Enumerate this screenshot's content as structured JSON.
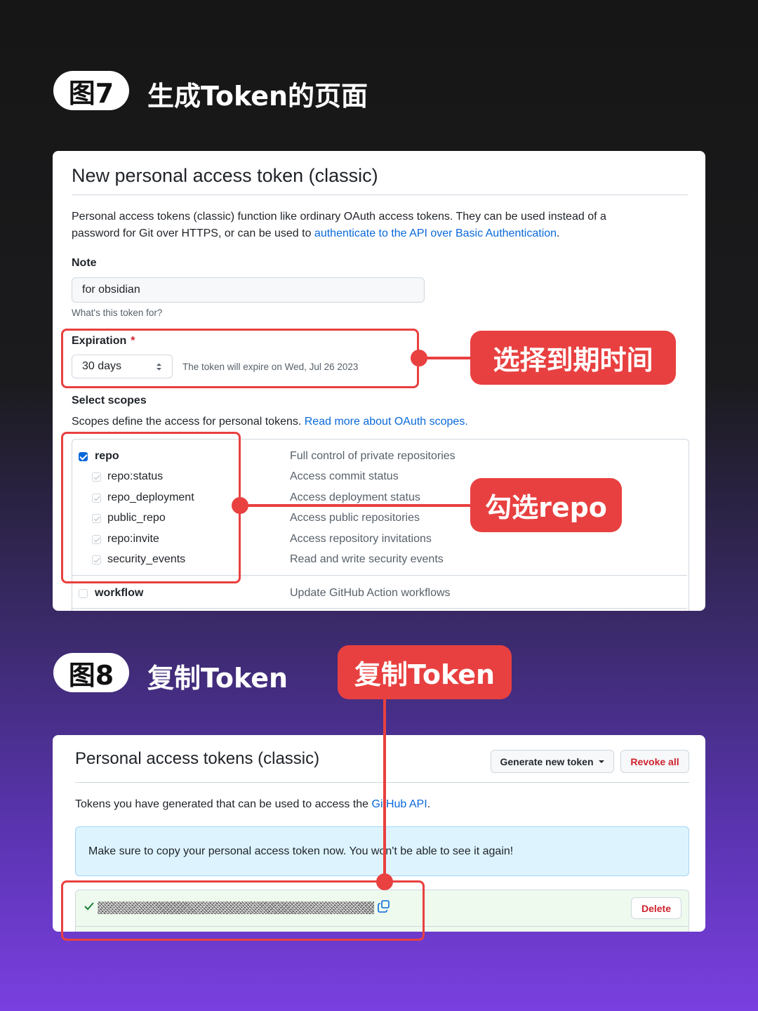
{
  "fig7": {
    "badge": "图7",
    "title": "生成Token的页面"
  },
  "fig8": {
    "badge": "图8",
    "title": "复制Token"
  },
  "card1": {
    "heading": "New personal access token (classic)",
    "intro_1": "Personal access tokens (classic) function like ordinary OAuth access tokens. They can be used instead of a",
    "intro_2_prefix": "password for Git over HTTPS, or can be used to ",
    "intro_2_link": "authenticate to the API over Basic Authentication",
    "intro_2_suffix": ".",
    "note_label": "Note",
    "note_value": "for obsidian",
    "note_hint": "What's this token for?",
    "expiration_label": "Expiration",
    "expiration_required": "*",
    "expiration_value": "30 days",
    "expiration_note": "The token will expire on Wed, Jul 26 2023",
    "scopes_label": "Select scopes",
    "scopes_desc_prefix": "Scopes define the access for personal tokens. ",
    "scopes_desc_link": "Read more about OAuth scopes.",
    "scopes": [
      {
        "name": "repo",
        "desc": "Full control of private repositories",
        "state": "checked"
      },
      {
        "name": "repo:status",
        "desc": "Access commit status",
        "state": "sub"
      },
      {
        "name": "repo_deployment",
        "desc": "Access deployment status",
        "state": "sub"
      },
      {
        "name": "public_repo",
        "desc": "Access public repositories",
        "state": "sub"
      },
      {
        "name": "repo:invite",
        "desc": "Access repository invitations",
        "state": "sub"
      },
      {
        "name": "security_events",
        "desc": "Read and write security events",
        "state": "sub"
      },
      {
        "name": "workflow",
        "desc": "Update GitHub Action workflows",
        "state": "unchecked"
      }
    ]
  },
  "card2": {
    "heading": "Personal access tokens (classic)",
    "generate_button": "Generate new token",
    "revoke_button": "Revoke all",
    "desc_prefix": "Tokens you have generated that can be used to access the ",
    "desc_link": "GitHub API",
    "desc_suffix": ".",
    "flash": "Make sure to copy your personal access token now. You won't be able to see it again!",
    "delete_button": "Delete"
  },
  "callouts": {
    "expiration": "选择到期时间",
    "repo": "勾选repo",
    "copy": "复制Token"
  },
  "colors": {
    "annotation_red": "#e84040",
    "link_blue": "#0969da",
    "danger": "#cf222e"
  }
}
